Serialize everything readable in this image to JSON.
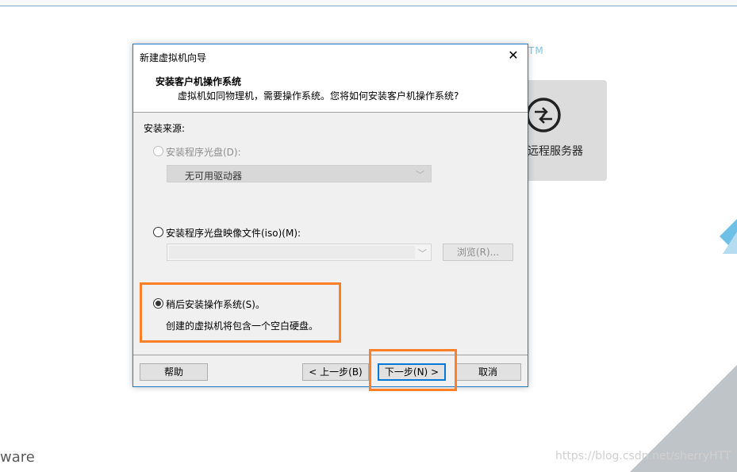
{
  "background": {
    "tm_mark": "TM",
    "card_label": "远程服务器",
    "brand_text": "ware",
    "watermark": "https://blog.csdn.net/sherryHTT"
  },
  "dialog": {
    "title": "新建虚拟机向导",
    "close_glyph": "✕",
    "header_title": "安装客户机操作系统",
    "header_subtitle": "虚拟机如同物理机，需要操作系统。您将如何安装客户机操作系统?",
    "section_label": "安装来源:",
    "options": [
      {
        "label": "安装程序光盘(D):",
        "selected": false,
        "enabled": false
      },
      {
        "label": "安装程序光盘映像文件(iso)(M):",
        "selected": false,
        "enabled": true
      },
      {
        "label": "稍后安装操作系统(S)。",
        "selected": true,
        "enabled": true
      }
    ],
    "drive_select_value": "无可用驱动器",
    "iso_path_value": "",
    "browse_label": "浏览(R)...",
    "later_description": "创建的虚拟机将包含一个空白硬盘。",
    "buttons": {
      "help": "帮助",
      "back": "< 上一步(B)",
      "next": "下一步(N) >",
      "cancel": "取消"
    }
  },
  "colors": {
    "highlight": "#ff7f27",
    "accent": "#0078d7"
  }
}
